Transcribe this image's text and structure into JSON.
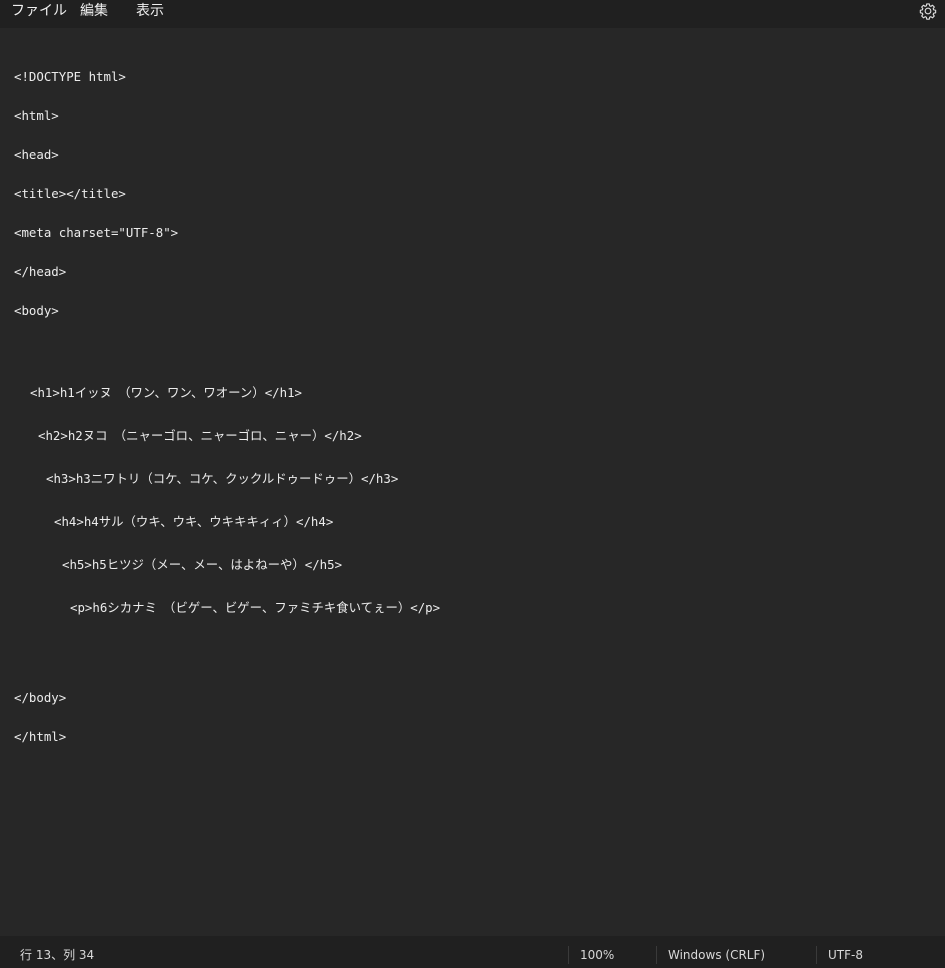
{
  "menu": {
    "file": "ファイル",
    "edit": "編集",
    "view": "表示"
  },
  "icons": {
    "settings": "gear-icon"
  },
  "editor": {
    "lines": [
      "<!DOCTYPE html>",
      "<html>",
      "<head>",
      "<title></title>",
      "<meta charset=\"UTF-8\">",
      "</head>",
      "<body>",
      "<h1>h1イッヌ　（ワン、ワン、ワオーン）</h1>",
      "<h2>h2ヌコ　（ニャーゴロ、ニャーゴロ、ニャー）</h2>",
      "<h3>h3ニワトリ（コケ、コケ、クックルドゥードゥー）</h3>",
      "<h4>h4サル（ウキ、ウキ、ウキキキィィ）</h4>",
      "<h5>h5ヒツジ（メー、メー、はよねーや）</h5>",
      "<p>h6シカナミ　（ビゲー、ビゲー、ファミチキ食いてぇー）</p>",
      "</body>",
      "</html>"
    ]
  },
  "status": {
    "position": "行 13、列 34",
    "zoom": "100%",
    "line_ending": "Windows (CRLF)",
    "encoding": "UTF-8"
  },
  "colors": {
    "background": "#272727",
    "bars": "#202020",
    "text": "#ececec"
  }
}
